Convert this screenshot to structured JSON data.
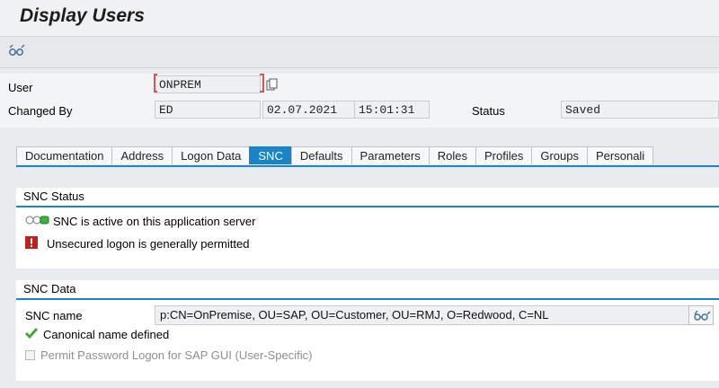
{
  "window": {
    "title": "Display Users"
  },
  "toolbar": {
    "other_user_icon": "glasses-icon"
  },
  "header": {
    "user_label": "User",
    "user_value": "ONPREM",
    "changed_by_label": "Changed By",
    "changed_by_value": "ED",
    "changed_date": "02.07.2021",
    "changed_time": "15:01:31",
    "status_label": "Status",
    "status_value": "Saved"
  },
  "tabs": [
    {
      "label": "Documentation",
      "active": false
    },
    {
      "label": "Address",
      "active": false
    },
    {
      "label": "Logon Data",
      "active": false
    },
    {
      "label": "SNC",
      "active": true
    },
    {
      "label": "Defaults",
      "active": false
    },
    {
      "label": "Parameters",
      "active": false
    },
    {
      "label": "Roles",
      "active": false
    },
    {
      "label": "Profiles",
      "active": false
    },
    {
      "label": "Groups",
      "active": false
    },
    {
      "label": "Personali",
      "active": false
    }
  ],
  "snc_status": {
    "title": "SNC Status",
    "active_msg": "SNC is active on this application server",
    "unsecured_msg": "Unsecured logon is generally permitted"
  },
  "snc_data": {
    "title": "SNC Data",
    "name_label": "SNC name",
    "name_value": "p:CN=OnPremise, OU=SAP, OU=Customer, OU=RMJ, O=Redwood, C=NL",
    "canonical_msg": "Canonical name defined",
    "permit_label": "Permit Password Logon for SAP GUI (User-Specific)"
  },
  "colors": {
    "accent": "#1a84c9",
    "error": "#c0211f",
    "success": "#4aa33a"
  }
}
